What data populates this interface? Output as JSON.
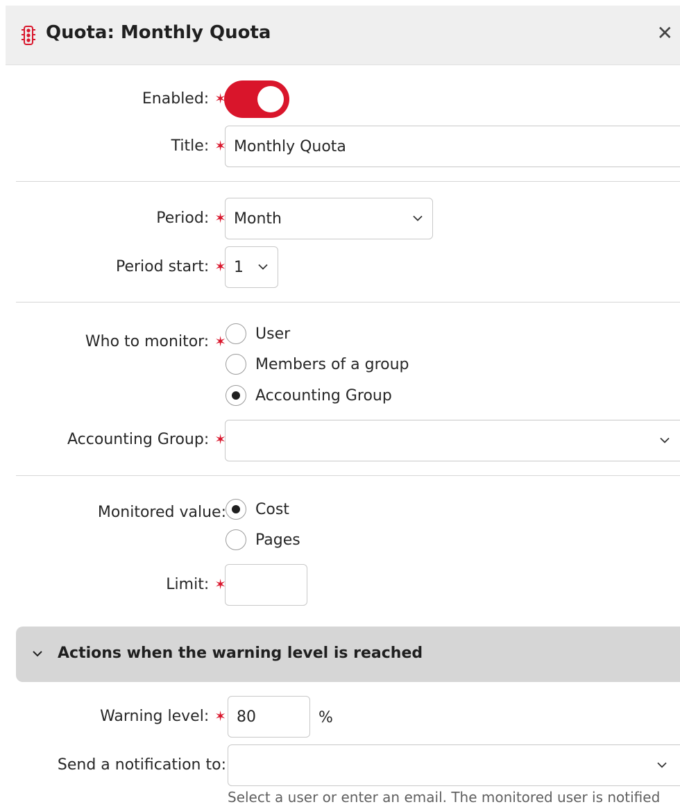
{
  "header": {
    "title": "Quota: Monthly Quota",
    "icon": "traffic-light-icon",
    "close_icon": "close-icon",
    "close_glyph": "✕"
  },
  "required_mark": "✶",
  "enabled": {
    "label": "Enabled:",
    "value": true
  },
  "title_field": {
    "label": "Title:",
    "value": "Monthly Quota"
  },
  "period": {
    "label": "Period:",
    "value": "Month"
  },
  "period_start": {
    "label": "Period start:",
    "value": "1"
  },
  "who_to_monitor": {
    "label": "Who to monitor:",
    "options": [
      "User",
      "Members of a group",
      "Accounting Group"
    ],
    "selected": "Accounting Group"
  },
  "accounting_group": {
    "label": "Accounting Group:",
    "value": ""
  },
  "monitored_value": {
    "label": "Monitored value:",
    "options": [
      "Cost",
      "Pages"
    ],
    "selected": "Cost"
  },
  "limit": {
    "label": "Limit:",
    "value": ""
  },
  "warning_section": {
    "title": "Actions when the warning level is reached",
    "expanded": true
  },
  "warning_level": {
    "label": "Warning level:",
    "value": "80",
    "unit": "%"
  },
  "send_notification": {
    "label": "Send a notification to:",
    "value": "",
    "hint": "Select a user or enter an email. The monitored user is notified"
  },
  "colors": {
    "accent": "#d9152b",
    "header_bg": "#efefef",
    "section_bg": "#d6d6d6"
  }
}
